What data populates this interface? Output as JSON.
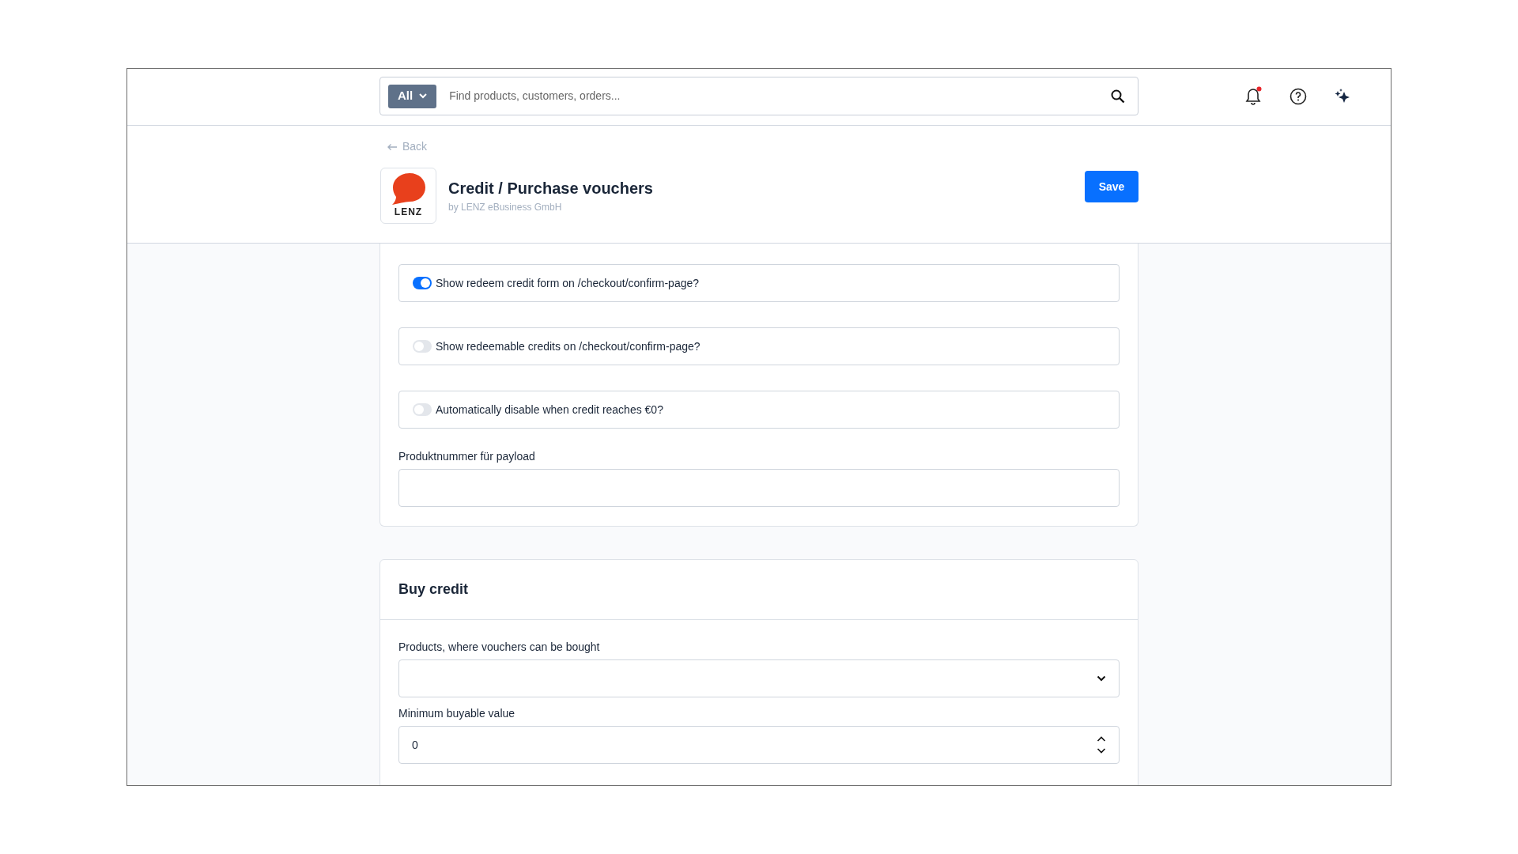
{
  "search": {
    "scope": "All",
    "placeholder": "Find products, customers, orders..."
  },
  "header": {
    "notification_unread": true
  },
  "back": "Back",
  "app": {
    "title": "Credit / Purchase vouchers",
    "vendor": "by LENZ eBusiness GmbH",
    "logo_text": "LENZ"
  },
  "save": "Save",
  "settings": [
    {
      "kind": "toggle",
      "label": "Show redeem credit form on /checkout/confirm-page?",
      "on": true
    },
    {
      "kind": "toggle",
      "label": "Show redeemable credits on /checkout/confirm-page?",
      "on": false
    },
    {
      "kind": "toggle",
      "label": "Automatically disable when credit reaches €0?",
      "on": false
    },
    {
      "kind": "text",
      "label": "Produktnummer für payload"
    }
  ],
  "buy_credit": {
    "title": "Buy credit",
    "fields": [
      {
        "kind": "select",
        "label": "Products, where vouchers can be bought"
      },
      {
        "kind": "number",
        "label": "Minimum buyable value",
        "value": "0"
      }
    ]
  }
}
